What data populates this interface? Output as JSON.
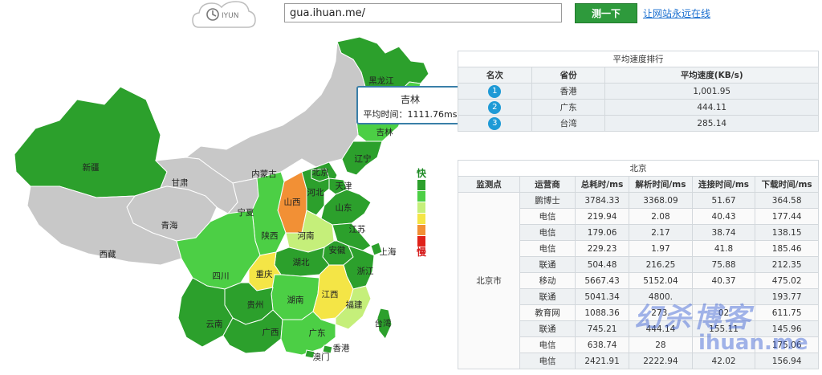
{
  "logo": {
    "text": "IYUN",
    "icon": "clock-icon"
  },
  "search": {
    "value": "gua.ihuan.me/",
    "button_label": "测一下",
    "promo_link": "让网站永远在线"
  },
  "provinces": [
    {
      "name": "黑龙江",
      "color": "#2ca02c"
    },
    {
      "name": "吉林",
      "color": "#4ccf45"
    },
    {
      "name": "辽宁",
      "color": "#2ca02c"
    },
    {
      "name": "内蒙古",
      "color": "#c8c8c8"
    },
    {
      "name": "新疆",
      "color": "#2ca02c"
    },
    {
      "name": "甘肃",
      "color": "#c8c8c8"
    },
    {
      "name": "青海",
      "color": "#c8c8c8"
    },
    {
      "name": "西藏",
      "color": "#c8c8c8"
    },
    {
      "name": "宁夏",
      "color": "#c8c8c8"
    },
    {
      "name": "山西",
      "color": "#f29035"
    },
    {
      "name": "河北",
      "color": "#2ca02c"
    },
    {
      "name": "北京",
      "color": "#2ca02c"
    },
    {
      "name": "天津",
      "color": "#2ca02c"
    },
    {
      "name": "山东",
      "color": "#2ca02c"
    },
    {
      "name": "陕西",
      "color": "#4ccf45"
    },
    {
      "name": "河南",
      "color": "#c5ef7a"
    },
    {
      "name": "江苏",
      "color": "#2ca02c"
    },
    {
      "name": "上海",
      "color": "#2ca02c"
    },
    {
      "name": "安徽",
      "color": "#2ca02c"
    },
    {
      "name": "湖北",
      "color": "#2ca02c"
    },
    {
      "name": "四川",
      "color": "#4ccf45"
    },
    {
      "name": "重庆",
      "color": "#f4e546"
    },
    {
      "name": "浙江",
      "color": "#2ca02c"
    },
    {
      "name": "湖南",
      "color": "#4ccf45"
    },
    {
      "name": "江西",
      "color": "#f4e546"
    },
    {
      "name": "福建",
      "color": "#c5ef7a"
    },
    {
      "name": "贵州",
      "color": "#2ca02c"
    },
    {
      "name": "云南",
      "color": "#2ca02c"
    },
    {
      "name": "广西",
      "color": "#2ca02c"
    },
    {
      "name": "广东",
      "color": "#4ccf45"
    },
    {
      "name": "台湾",
      "color": "#2ca02c"
    },
    {
      "name": "香港",
      "color": "#2ca02c"
    },
    {
      "name": "澳门",
      "color": "#2ca02c"
    }
  ],
  "tooltip": {
    "title": "吉林",
    "line": "平均时间：1111.76ms"
  },
  "legend": {
    "fast": "快",
    "slow": "慢",
    "colors": [
      "#2ca02c",
      "#4ccf45",
      "#c5ef7a",
      "#f4e546",
      "#f29035",
      "#e0221a"
    ]
  },
  "ranking": {
    "title": "平均速度排行",
    "headers": [
      "名次",
      "省份",
      "平均速度(KB/s)"
    ],
    "rows": [
      {
        "rank": "1",
        "province": "香港",
        "speed": "1,001.95"
      },
      {
        "rank": "2",
        "province": "广东",
        "speed": "444.11"
      },
      {
        "rank": "3",
        "province": "台湾",
        "speed": "285.14"
      }
    ]
  },
  "beijing": {
    "title": "北京",
    "headers": [
      "监测点",
      "运营商",
      "总耗时/ms",
      "解析时间/ms",
      "连接时间/ms",
      "下载时间/ms"
    ],
    "city": "北京市",
    "rows": [
      [
        "鹏博士",
        "3784.33",
        "3368.09",
        "51.67",
        "364.58"
      ],
      [
        "电信",
        "219.94",
        "2.08",
        "40.43",
        "177.44"
      ],
      [
        "电信",
        "179.06",
        "2.17",
        "38.74",
        "138.15"
      ],
      [
        "电信",
        "229.23",
        "1.97",
        "41.8",
        "185.46"
      ],
      [
        "联通",
        "504.48",
        "216.25",
        "75.88",
        "212.35"
      ],
      [
        "移动",
        "5667.43",
        "5152.04",
        "40.37",
        "475.02"
      ],
      [
        "联通",
        "5041.34",
        "4800.",
        "",
        "193.77"
      ],
      [
        "教育网",
        "1088.36",
        "273.",
        "02",
        "611.75"
      ],
      [
        "联通",
        "745.21",
        "444.14",
        "155.11",
        "145.96"
      ],
      [
        "电信",
        "638.74",
        "28",
        "",
        "175.06"
      ],
      [
        "电信",
        "2421.91",
        "2222.94",
        "42.02",
        "156.94"
      ]
    ]
  },
  "watermark": {
    "text": "幻杀博客",
    "site": "ihuan.me"
  }
}
